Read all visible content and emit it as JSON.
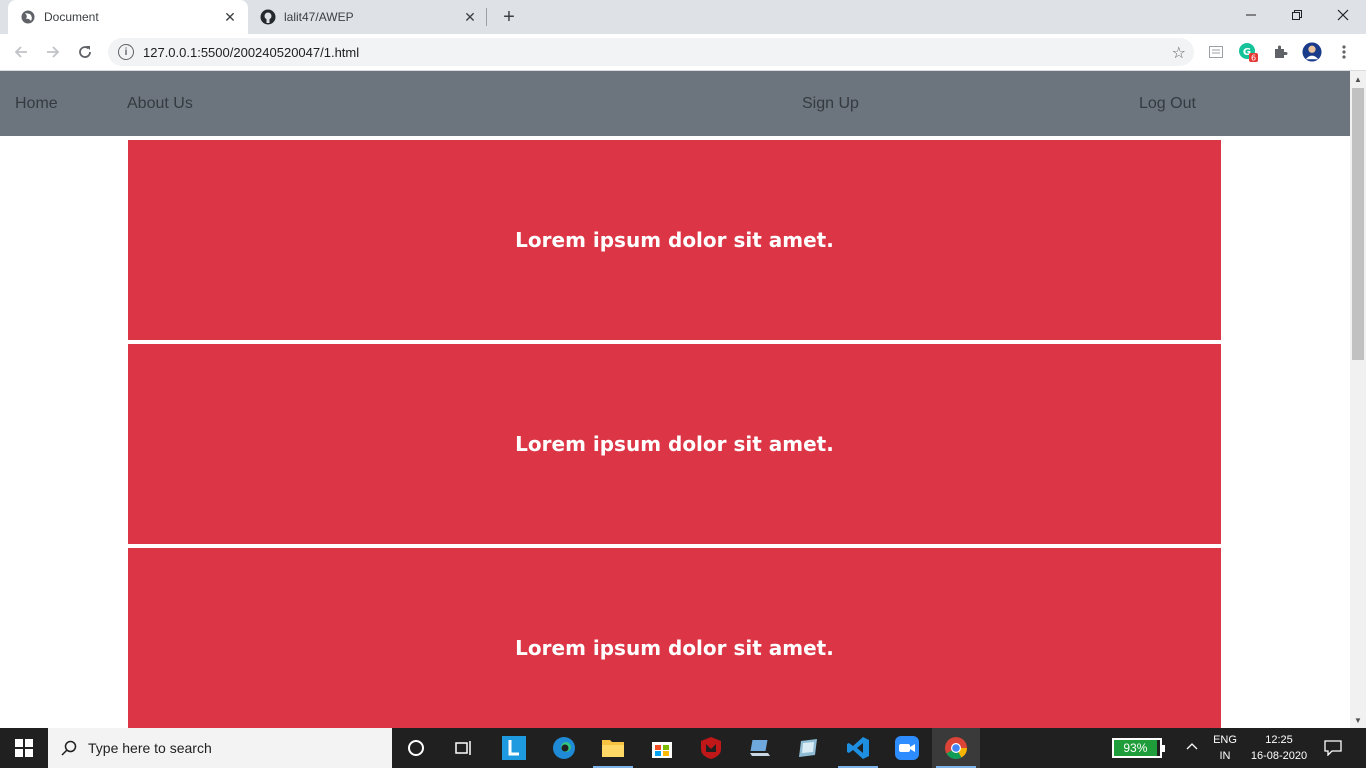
{
  "browser": {
    "tabs": [
      {
        "title": "Document",
        "icon": "globe-icon",
        "active": true
      },
      {
        "title": "lalit47/AWEP",
        "icon": "github-icon",
        "active": false
      }
    ],
    "url": "127.0.0.1:5500/200240520047/1.html",
    "extensions": [
      {
        "name": "reader-mode-icon"
      },
      {
        "name": "grammarly-extension-icon",
        "badge": "6"
      },
      {
        "name": "extensions-puzzle-icon"
      },
      {
        "name": "profile-avatar"
      }
    ]
  },
  "page": {
    "nav": {
      "home": "Home",
      "about": "About Us",
      "signup": "Sign Up",
      "logout": "Log Out"
    },
    "cards": [
      {
        "text": "Lorem ipsum dolor sit amet."
      },
      {
        "text": "Lorem ipsum dolor sit amet."
      },
      {
        "text": "Lorem ipsum dolor sit amet."
      }
    ],
    "colors": {
      "navbar": "#6c757d",
      "card": "#dc3545",
      "card_text": "#ffffff"
    }
  },
  "taskbar": {
    "search_placeholder": "Type here to search",
    "apps": [
      "cortana-icon",
      "task-view-icon",
      "app-l-icon",
      "edge-icon",
      "file-explorer-icon",
      "store-icon",
      "mcafee-icon",
      "laptop-app-icon",
      "app-tile-icon",
      "vscode-icon",
      "zoom-icon",
      "chrome-icon"
    ],
    "battery_percent": "93%",
    "language_top": "ENG",
    "language_bottom": "IN",
    "time": "12:25",
    "date": "16-08-2020"
  }
}
